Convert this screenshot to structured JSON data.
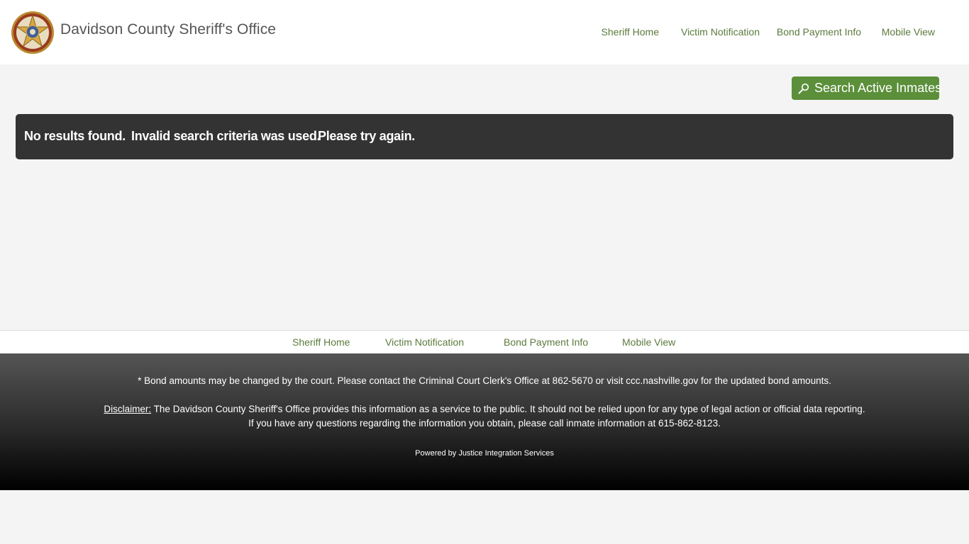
{
  "header": {
    "title": "Davidson County Sheriff's Office",
    "logo_icon": "sheriff-star-badge-icon",
    "nav": [
      {
        "label": "Sheriff Home"
      },
      {
        "label": "Victim Notification"
      },
      {
        "label": "Bond Payment Info"
      },
      {
        "label": "Mobile View"
      }
    ]
  },
  "search_button": {
    "label": "Search Active Inmates",
    "icon": "search-icon"
  },
  "alert": {
    "parts": [
      "No results found.",
      "Invalid search criteria was used.",
      "Please try again."
    ]
  },
  "bottom_nav": [
    {
      "label": "Sheriff Home"
    },
    {
      "label": "Victim Notification"
    },
    {
      "label": "Bond Payment Info"
    },
    {
      "label": "Mobile View"
    }
  ],
  "footer": {
    "bond_note": "* Bond amounts may be changed by the court. Please contact the Criminal Court Clerk's Office at 862-5670 or visit ccc.nashville.gov for the updated bond amounts.",
    "disclaimer_label": "Disclaimer:",
    "disclaimer_text": " The Davidson County Sheriff's Office provides this information as a service to the public. It should not be relied upon for any type of legal action or official data reporting.",
    "questions": "If you have any questions regarding the information you obtain, please call inmate information at 615-862-8123.",
    "powered_by": "Powered by Justice Integration Services"
  },
  "colors": {
    "nav_link": "#5b7a3c",
    "button_bg": "#5b8f3a",
    "alert_bg": "#333333",
    "page_bg": "#f4f4f4"
  }
}
